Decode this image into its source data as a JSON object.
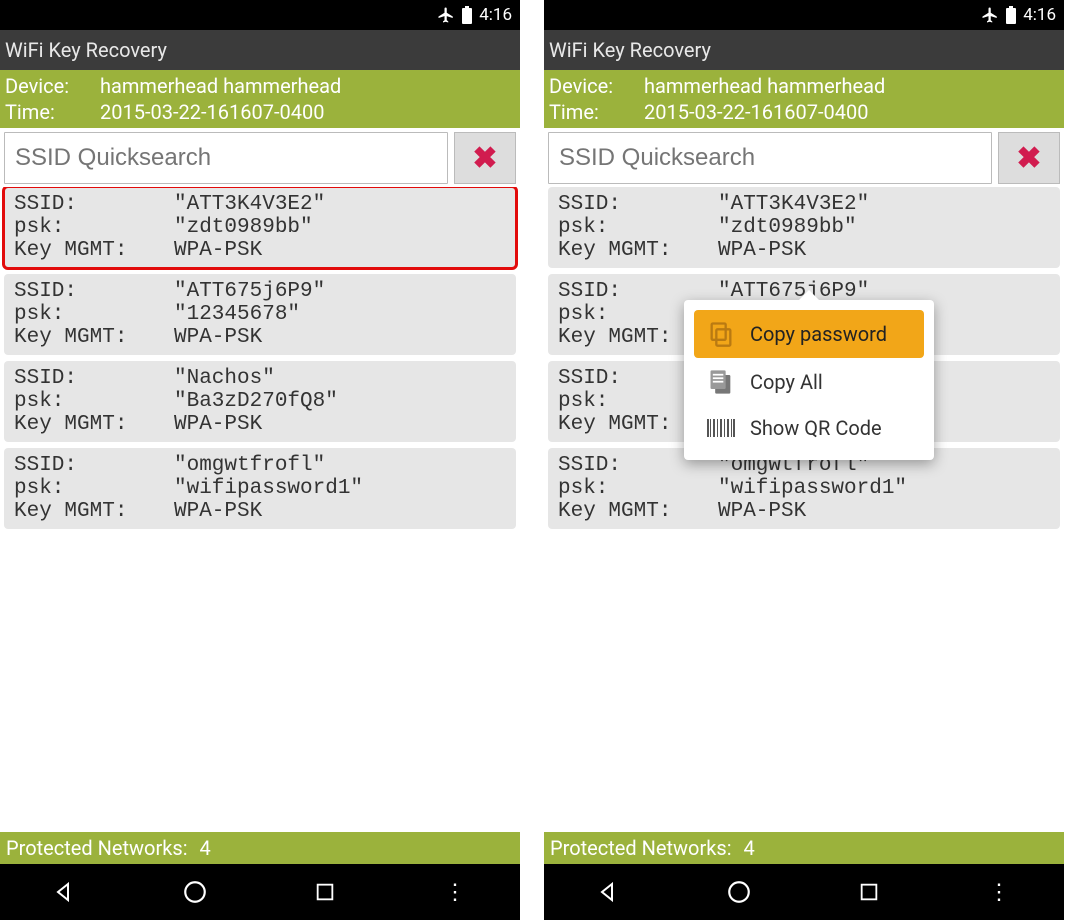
{
  "status": {
    "time": "4:16"
  },
  "app": {
    "title": "WiFi Key Recovery"
  },
  "meta": {
    "device_label": "Device:",
    "device_value": "hammerhead hammerhead",
    "time_label": "Time:",
    "time_value": "2015-03-22-161607-0400"
  },
  "search": {
    "placeholder": "SSID Quicksearch"
  },
  "labels": {
    "ssid": "SSID:",
    "psk": "psk:",
    "kmgmt": "Key MGMT:"
  },
  "networks": [
    {
      "ssid": "\"ATT3K4V3E2\"",
      "psk": "\"zdt0989bb\"",
      "kmgmt": "WPA-PSK"
    },
    {
      "ssid": "\"ATT675j6P9\"",
      "psk": "\"12345678\"",
      "kmgmt": "WPA-PSK"
    },
    {
      "ssid": "\"Nachos\"",
      "psk": "\"Ba3zD270fQ8\"",
      "kmgmt": "WPA-PSK"
    },
    {
      "ssid": "\"omgwtfrofl\"",
      "psk": "\"wifipassword1\"",
      "kmgmt": "WPA-PSK"
    }
  ],
  "footer": {
    "label": "Protected Networks:",
    "count": "4"
  },
  "popup": {
    "items": [
      {
        "label": "Copy password",
        "icon": "copy-icon",
        "selected": true
      },
      {
        "label": "Copy All",
        "icon": "copy-all-icon",
        "selected": false
      },
      {
        "label": "Show QR Code",
        "icon": "barcode-icon",
        "selected": false
      }
    ]
  }
}
